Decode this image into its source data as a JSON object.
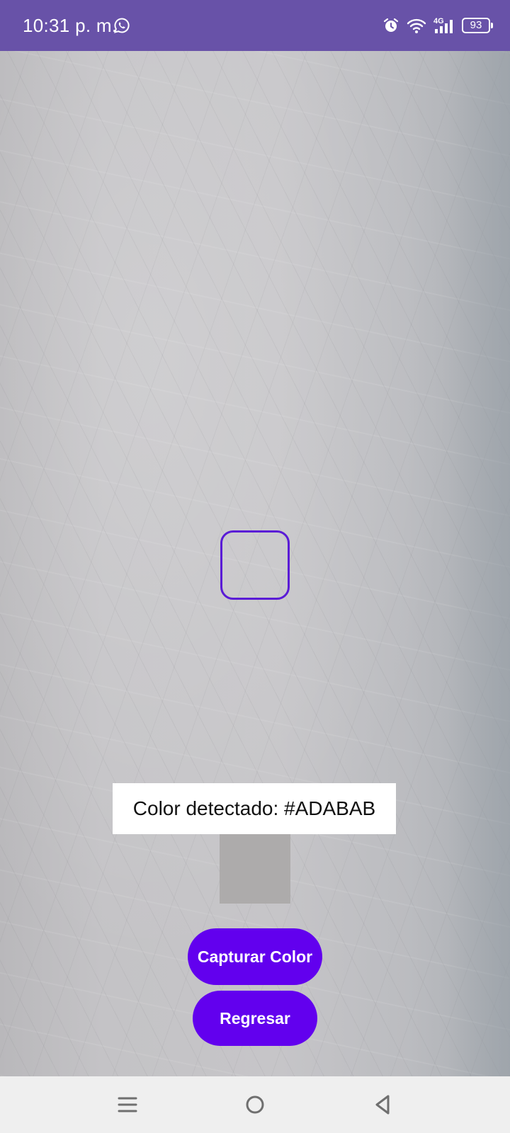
{
  "status_bar": {
    "time": "10:31 p. m.",
    "network": "4G",
    "battery": "93",
    "background_color": "#6852a8"
  },
  "camera": {
    "reticle_color": "#5a1bd6",
    "detected_label": "Color detectado: #ADABAB",
    "swatch_color": "#ADABAB"
  },
  "actions": {
    "capture_label": "Capturar Color",
    "back_label": "Regresar",
    "button_color": "#6200ee"
  },
  "nav": {
    "icons": [
      "menu-icon",
      "home-icon",
      "back-icon"
    ]
  }
}
